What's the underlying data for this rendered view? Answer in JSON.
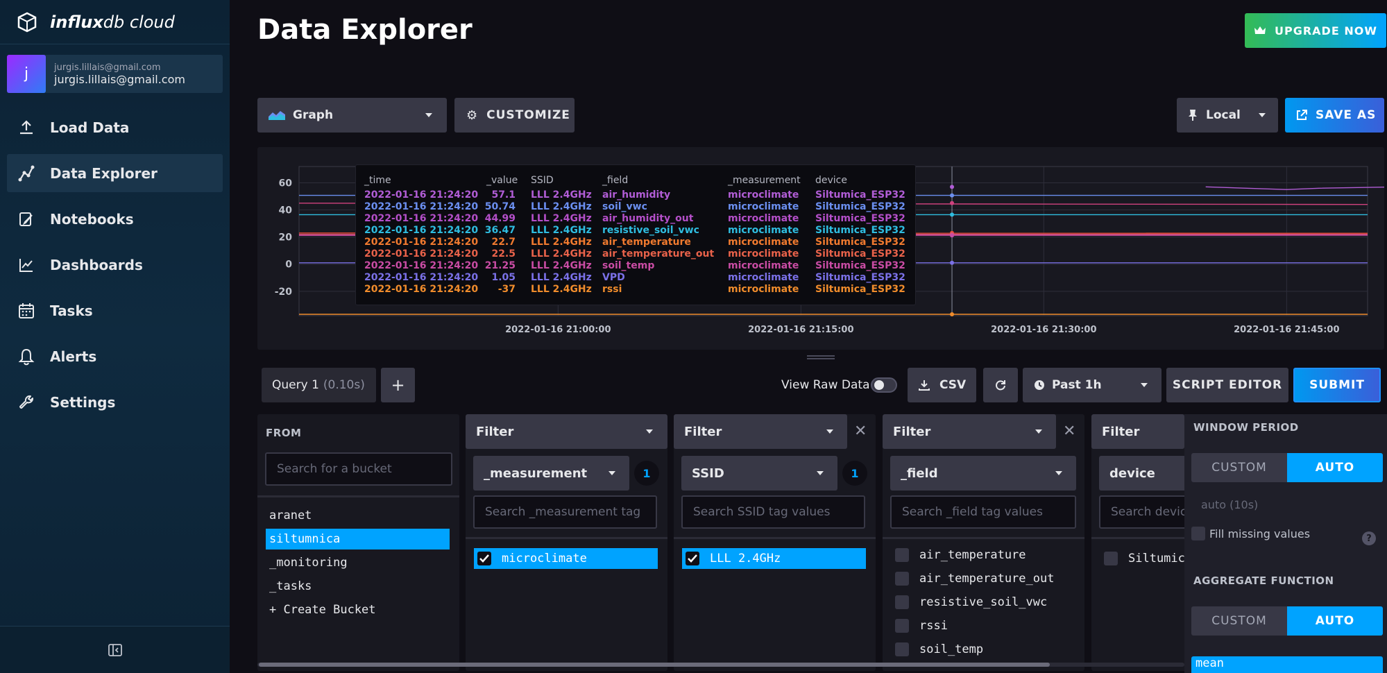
{
  "app": {
    "brand_bold": "influx",
    "brand_rest": "db cloud"
  },
  "user": {
    "initial": "j",
    "email_small": "jurgis.lillais@gmail.com",
    "email": "jurgis.lillais@gmail.com"
  },
  "nav": [
    {
      "label": "Load Data",
      "icon": "upload-icon"
    },
    {
      "label": "Data Explorer",
      "icon": "graph-icon"
    },
    {
      "label": "Notebooks",
      "icon": "notebook-icon"
    },
    {
      "label": "Dashboards",
      "icon": "chart-icon"
    },
    {
      "label": "Tasks",
      "icon": "calendar-icon"
    },
    {
      "label": "Alerts",
      "icon": "bell-icon"
    },
    {
      "label": "Settings",
      "icon": "wrench-icon"
    }
  ],
  "header": {
    "title": "Data Explorer",
    "upgrade_label": "UPGRADE NOW"
  },
  "toolbar": {
    "vis_type": "Graph",
    "customize_label": "CUSTOMIZE",
    "timezone": "Local",
    "save_as_label": "SAVE AS"
  },
  "chart_data": {
    "type": "line",
    "yticks": [
      60,
      40,
      20,
      0,
      -20
    ],
    "ylim": [
      -38,
      72
    ],
    "xticks": [
      "2022-01-16 21:00:00",
      "2022-01-16 21:15:00",
      "2022-01-16 21:30:00",
      "2022-01-16 21:45:00"
    ],
    "xlim_minutes": [
      -16,
      50
    ],
    "hover_minute": 24.33,
    "series": [
      {
        "field": "air_humidity",
        "color": "#b15dd6",
        "values": [
          [
            40,
            57
          ],
          [
            45,
            55
          ],
          [
            47,
            56
          ],
          [
            52,
            57
          ],
          [
            55,
            56
          ],
          [
            57,
            58
          ],
          [
            59,
            58
          ],
          [
            62,
            57
          ],
          [
            66,
            56
          ],
          [
            70,
            57
          ]
        ]
      },
      {
        "field": "soil_vwc",
        "color": "#6b8ff0",
        "values": [
          [
            -16,
            50.7
          ],
          [
            50,
            50.7
          ]
        ]
      },
      {
        "field": "air_humidity_out",
        "color": "#d0427e",
        "values": [
          [
            -16,
            45
          ],
          [
            50,
            44
          ]
        ]
      },
      {
        "field": "resistive_soil_vwc",
        "color": "#2fbde0",
        "values": [
          [
            -16,
            36.5
          ],
          [
            50,
            36.5
          ]
        ]
      },
      {
        "field": "air_temperature",
        "color": "#e84b35",
        "values": [
          [
            -16,
            23
          ],
          [
            50,
            22.8
          ]
        ]
      },
      {
        "field": "air_temperature_out",
        "color": "#e0547a",
        "values": [
          [
            -16,
            22
          ],
          [
            50,
            22
          ]
        ]
      },
      {
        "field": "soil_temp",
        "color": "#c94ca4",
        "values": [
          [
            -16,
            21.2
          ],
          [
            50,
            21.3
          ]
        ]
      },
      {
        "field": "VPD",
        "color": "#7b71e8",
        "values": [
          [
            -16,
            1
          ],
          [
            50,
            1
          ]
        ]
      },
      {
        "field": "rssi",
        "color": "#f08c2c",
        "values": [
          [
            -16,
            -37
          ],
          [
            50,
            -37
          ]
        ]
      }
    ]
  },
  "tooltip": {
    "headers": {
      "time": "_time",
      "value": "_value",
      "ssid": "SSID",
      "field": "_field",
      "measurement": "_measurement",
      "device": "device"
    },
    "rows": [
      {
        "time": "2022-01-16 21:24:20",
        "value": "57.1",
        "ssid": "LLL 2.4GHz",
        "field": "air_humidity",
        "measurement": "microclimate",
        "device": "Siltumica_ESP32",
        "color": "#b15dd6"
      },
      {
        "time": "2022-01-16 21:24:20",
        "value": "50.74",
        "ssid": "LLL 2.4GHz",
        "field": "soil_vwc",
        "measurement": "microclimate",
        "device": "Siltumica_ESP32",
        "color": "#6b8ff0"
      },
      {
        "time": "2022-01-16 21:24:20",
        "value": "44.99",
        "ssid": "LLL 2.4GHz",
        "field": "air_humidity_out",
        "measurement": "microclimate",
        "device": "Siltumica_ESP32",
        "color": "#b44fc9"
      },
      {
        "time": "2022-01-16 21:24:20",
        "value": "36.47",
        "ssid": "LLL 2.4GHz",
        "field": "resistive_soil_vwc",
        "measurement": "microclimate",
        "device": "Siltumica_ESP32",
        "color": "#2fbde0"
      },
      {
        "time": "2022-01-16 21:24:20",
        "value": "22.7",
        "ssid": "LLL 2.4GHz",
        "field": "air_temperature",
        "measurement": "microclimate",
        "device": "Siltumica_ESP32",
        "color": "#f07a2f"
      },
      {
        "time": "2022-01-16 21:24:20",
        "value": "22.5",
        "ssid": "LLL 2.4GHz",
        "field": "air_temperature_out",
        "measurement": "microclimate",
        "device": "Siltumica_ESP32",
        "color": "#e8624a"
      },
      {
        "time": "2022-01-16 21:24:20",
        "value": "21.25",
        "ssid": "LLL 2.4GHz",
        "field": "soil_temp",
        "measurement": "microclimate",
        "device": "Siltumica_ESP32",
        "color": "#c94ca4"
      },
      {
        "time": "2022-01-16 21:24:20",
        "value": "1.05",
        "ssid": "LLL 2.4GHz",
        "field": "VPD",
        "measurement": "microclimate",
        "device": "Siltumica_ESP32",
        "color": "#7b71e8"
      },
      {
        "time": "2022-01-16 21:24:20",
        "value": "-37",
        "ssid": "LLL 2.4GHz",
        "field": "rssi",
        "measurement": "microclimate",
        "device": "Siltumica_ESP32",
        "color": "#f08c2c"
      }
    ]
  },
  "query": {
    "tab_label": "Query 1",
    "tab_time": "(0.10s)",
    "add_label": "+",
    "view_raw_label": "View Raw Data",
    "csv_label": "CSV",
    "time_range": "Past 1h",
    "script_editor_label": "SCRIPT EDITOR",
    "submit_label": "SUBMIT"
  },
  "from": {
    "title": "FROM",
    "search_placeholder": "Search for a bucket",
    "buckets": [
      "aranet",
      "siltumnica",
      "_monitoring",
      "_tasks",
      "+ Create Bucket"
    ],
    "selected": "siltumnica"
  },
  "filters": [
    {
      "head": "Filter",
      "key": "_measurement",
      "count": "1",
      "search": "Search _measurement tag",
      "values": [
        "microclimate"
      ]
    },
    {
      "head": "Filter",
      "key": "SSID",
      "count": "1",
      "search": "Search SSID tag values",
      "values": [
        "LLL 2.4GHz"
      ]
    },
    {
      "head": "Filter",
      "key": "_field",
      "search": "Search _field tag values",
      "values": [
        "air_temperature",
        "air_temperature_out",
        "resistive_soil_vwc",
        "rssi",
        "soil_temp"
      ]
    },
    {
      "head": "Filter",
      "key": "device",
      "search": "Search devic",
      "values": [
        "Siltumic"
      ]
    }
  ],
  "window": {
    "period_title": "WINDOW PERIOD",
    "custom_label": "CUSTOM",
    "auto_label": "AUTO",
    "auto_value": "auto (10s)",
    "fill_missing_label": "Fill missing values",
    "help": "?",
    "aggregate_title": "AGGREGATE FUNCTION",
    "agg_custom_label": "CUSTOM",
    "agg_auto_label": "AUTO",
    "agg_selected": "mean"
  }
}
